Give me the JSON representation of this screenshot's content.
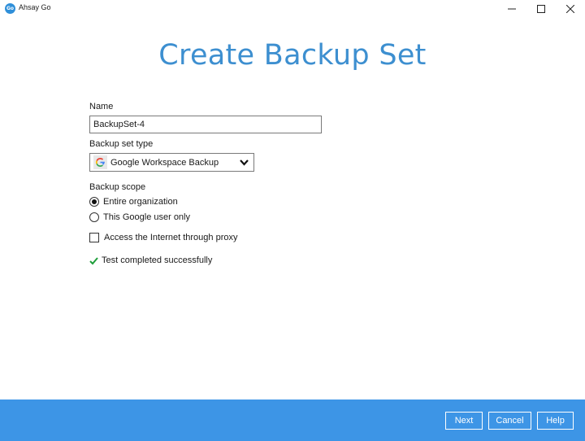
{
  "window": {
    "title": "Ahsay Go",
    "logo_text": "Go"
  },
  "page": {
    "title": "Create Backup Set"
  },
  "form": {
    "name_label": "Name",
    "name_value": "BackupSet-4",
    "type_label": "Backup set type",
    "type_value": "Google Workspace Backup",
    "scope_label": "Backup scope",
    "scope_options": [
      {
        "label": "Entire organization",
        "selected": true
      },
      {
        "label": "This Google user only",
        "selected": false
      }
    ],
    "proxy_label": "Access the Internet through proxy",
    "proxy_checked": false,
    "status_text": "Test completed successfully"
  },
  "footer": {
    "next_label": "Next",
    "cancel_label": "Cancel",
    "help_label": "Help"
  },
  "colors": {
    "accent": "#3d8fd0",
    "footer_bg": "#3d95e6",
    "success": "#1e9e3a"
  },
  "icons": {
    "logo": "ahsay-go-logo-icon",
    "type": "google-g-icon",
    "dropdown": "chevron-down-icon",
    "status": "checkmark-icon"
  }
}
